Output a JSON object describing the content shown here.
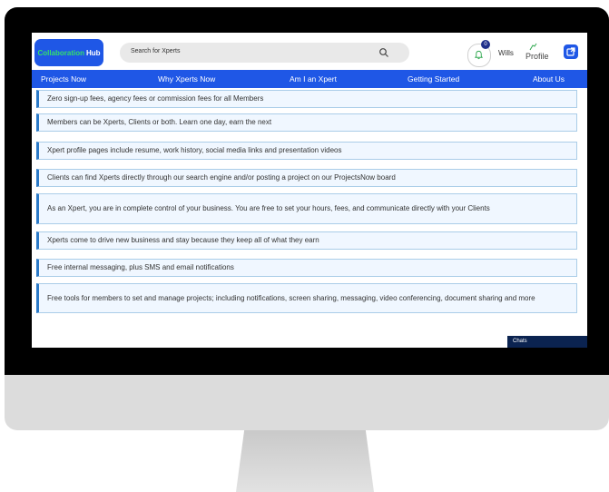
{
  "header": {
    "logo_primary": "Collaboration",
    "logo_secondary": "Hub",
    "search_placeholder": "Search for Xperts",
    "notification_count": "0",
    "user_name": "Wills",
    "profile_label": "Profile"
  },
  "nav": {
    "items": [
      {
        "label": "Projects Now"
      },
      {
        "label": "Why Xperts Now"
      },
      {
        "label": "Am I an Xpert"
      },
      {
        "label": "Getting Started"
      },
      {
        "label": "About Us"
      }
    ]
  },
  "features": [
    "Zero sign-up fees, agency fees or commission fees for all Members",
    "Members can be Xperts, Clients or both. Learn one day, earn the next",
    "Xpert profile pages include resume, work history, social media links and presentation videos",
    "Clients can find Xperts directly through our search engine and/or posting a project on our ProjectsNow board",
    "As an Xpert, you are in complete control of your business. You are free to set your hours, fees, and communicate directly with your Clients",
    "Xperts come to drive new business and stay because they keep all of what they earn",
    "Free internal messaging, plus SMS and email notifications",
    "Free tools for members to set and manage projects; including notifications, screen sharing, messaging, video conferencing, document sharing and more"
  ],
  "chats": {
    "label": "Chats"
  },
  "colors": {
    "brand_blue": "#1f57e6",
    "logo_green": "#34e06a",
    "item_border": "#2b7ac8",
    "item_background": "#f0f7ff",
    "chats_bar": "#0b2350"
  }
}
